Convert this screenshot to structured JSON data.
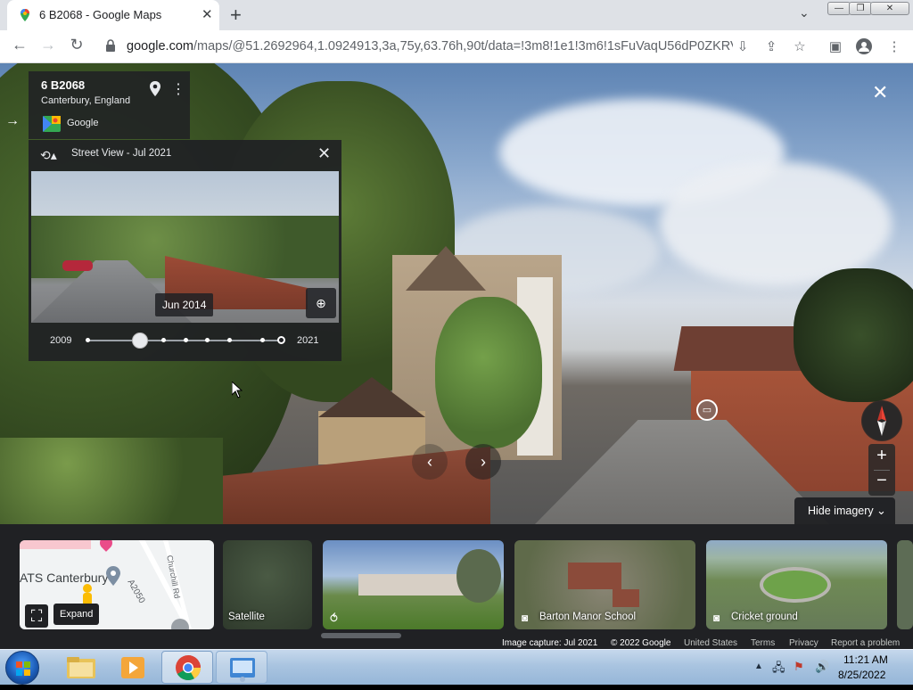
{
  "browser": {
    "tab_title": "6 B2068 - Google Maps",
    "url_host": "google.com",
    "url_rest": "/maps/@51.2692964,1.0924913,3a,75y,63.76h,90t/data=!3m8!1e1!3m6!1sFuVaqU56dP0ZKRVM..."
  },
  "place": {
    "title": "6 B2068",
    "subtitle": "Canterbury, England",
    "provider": "Google"
  },
  "time_machine": {
    "header": "Street View - Jul 2021",
    "selected_label": "Jun 2014",
    "year_start": "2009",
    "year_end": "2021"
  },
  "controls": {
    "hide_imagery": "Hide imagery"
  },
  "cards": {
    "expand_tooltip": "Expand",
    "map_labels": [
      "ATS Canterbury",
      "Churchill Rd",
      "A2050"
    ],
    "satellite": "Satellite",
    "barton": "Barton Manor School",
    "cricket": "Cricket ground"
  },
  "footer": {
    "capture": "Image capture: Jul 2021",
    "copyright": "© 2022 Google",
    "country": "United States",
    "terms": "Terms",
    "privacy": "Privacy",
    "report": "Report a problem"
  },
  "taskbar": {
    "time": "11:21 AM",
    "date": "8/25/2022"
  },
  "colors": {
    "panel": "#202124",
    "taskbar": "#a9c4e0",
    "accent": "#1a73e8"
  }
}
